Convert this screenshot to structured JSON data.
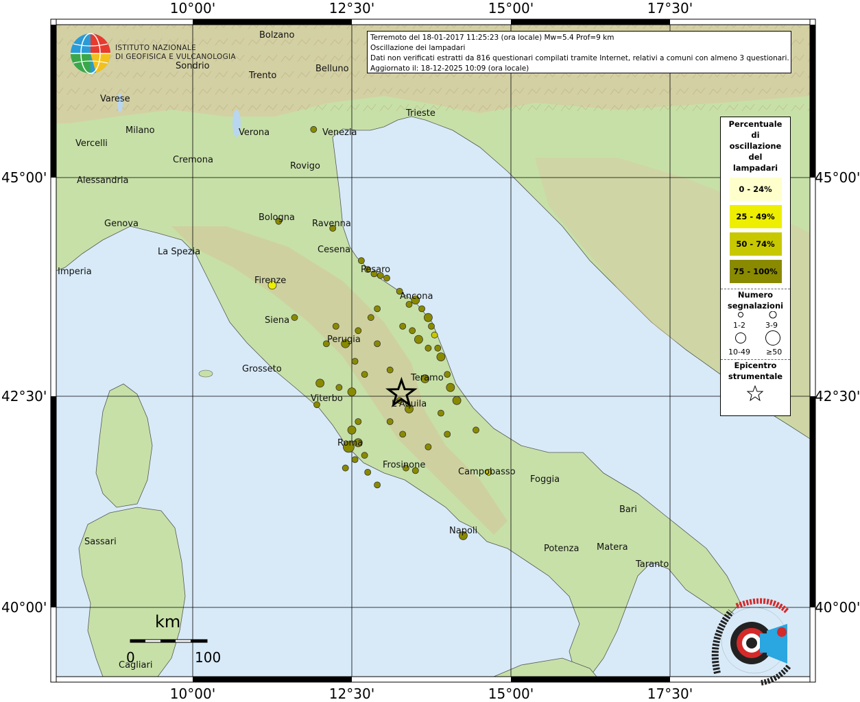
{
  "info_box": {
    "line1": "Terremoto del 18-01-2017 11:25:23 (ora locale) Mw=5.4 Prof=9 km",
    "line2": "Oscillazione dei lampadari",
    "line3": "Dati non verificati estratti da 816 questionari compilati tramite Internet, relativi a comuni con almeno 3 questionari.",
    "line4": "Aggiornato il: 18-12-2025 10:09 (ora locale)"
  },
  "logo": {
    "line1": "ISTITUTO NAZIONALE",
    "line2": "DI GEOFISICA E VULCANOLOGIA",
    "icon": "ingv-globe-icon"
  },
  "axes": {
    "top": [
      "10°00'",
      "12°30'",
      "15°00'",
      "17°30'"
    ],
    "bottom": [
      "10°00'",
      "12°30'",
      "15°00'",
      "17°30'"
    ],
    "left": [
      "45°00'",
      "42°30'",
      "40°00'"
    ],
    "right": [
      "45°00'",
      "42°30'",
      "40°00'"
    ]
  },
  "legend": {
    "title_lines": [
      "Percentuale",
      "di",
      "oscillazione",
      "del",
      "lampadari"
    ],
    "classes": [
      {
        "label": "0 - 24%",
        "color": "#ffffcc"
      },
      {
        "label": "25 - 49%",
        "color": "#eeee00"
      },
      {
        "label": "50 - 74%",
        "color": "#c8c800"
      },
      {
        "label": "75 - 100%",
        "color": "#8a8a00"
      }
    ],
    "count_title_lines": [
      "Numero",
      "segnalazioni"
    ],
    "count_classes": [
      "1-2",
      "3-9",
      "10-49",
      "≥50"
    ],
    "epicenter_title_lines": [
      "Epicentro",
      "strumentale"
    ],
    "epicenter_icon": "star-icon"
  },
  "scale": {
    "unit": "km",
    "min": "0",
    "max": "100"
  },
  "cities": [
    "Bolzano",
    "Sondrio",
    "Trento",
    "Belluno",
    "Varese",
    "Milano",
    "Verona",
    "Venezia",
    "Trieste",
    "Vercelli",
    "Cremona",
    "Rovigo",
    "Alessandria",
    "Genova",
    "Bologna",
    "Ravenna",
    "La Spezia",
    "Cesena",
    "Pesaro",
    "Imperia",
    "Firenze",
    "Ancona",
    "Siena",
    "Perugia",
    "Teramo",
    "Grosseto",
    "Viterbo",
    "L'Aquila",
    "Roma",
    "Frosinone",
    "Campobasso",
    "Foggia",
    "Bari",
    "Napoli",
    "Sassari",
    "Potenza",
    "Matera",
    "Taranto",
    "Cagliari"
  ],
  "map": {
    "sea_color": "#d8eaf8",
    "land_color": "#c7e0a8",
    "epicenter": {
      "lon": 13.28,
      "lat": 42.53
    },
    "observations": [
      {
        "lon": 11.9,
        "lat": 45.55,
        "cls": 3,
        "size": 1
      },
      {
        "lon": 11.35,
        "lat": 44.5,
        "cls": 3,
        "size": 1
      },
      {
        "lon": 12.2,
        "lat": 44.42,
        "cls": 3,
        "size": 1
      },
      {
        "lon": 11.25,
        "lat": 43.77,
        "cls": 1,
        "size": 2
      },
      {
        "lon": 12.65,
        "lat": 44.05,
        "cls": 3,
        "size": 1
      },
      {
        "lon": 12.75,
        "lat": 43.95,
        "cls": 3,
        "size": 1
      },
      {
        "lon": 12.85,
        "lat": 43.9,
        "cls": 3,
        "size": 1
      },
      {
        "lon": 12.95,
        "lat": 43.88,
        "cls": 3,
        "size": 1
      },
      {
        "lon": 13.05,
        "lat": 43.85,
        "cls": 3,
        "size": 1
      },
      {
        "lon": 13.25,
        "lat": 43.7,
        "cls": 3,
        "size": 1
      },
      {
        "lon": 13.5,
        "lat": 43.6,
        "cls": 3,
        "size": 2
      },
      {
        "lon": 13.4,
        "lat": 43.55,
        "cls": 3,
        "size": 1
      },
      {
        "lon": 13.6,
        "lat": 43.5,
        "cls": 3,
        "size": 1
      },
      {
        "lon": 13.7,
        "lat": 43.4,
        "cls": 3,
        "size": 2
      },
      {
        "lon": 13.75,
        "lat": 43.3,
        "cls": 3,
        "size": 1
      },
      {
        "lon": 13.8,
        "lat": 43.2,
        "cls": 2,
        "size": 1
      },
      {
        "lon": 13.85,
        "lat": 43.05,
        "cls": 3,
        "size": 1
      },
      {
        "lon": 13.9,
        "lat": 42.95,
        "cls": 3,
        "size": 2
      },
      {
        "lon": 13.7,
        "lat": 43.05,
        "cls": 3,
        "size": 1
      },
      {
        "lon": 13.55,
        "lat": 43.15,
        "cls": 3,
        "size": 2
      },
      {
        "lon": 13.45,
        "lat": 43.25,
        "cls": 3,
        "size": 1
      },
      {
        "lon": 13.3,
        "lat": 43.3,
        "cls": 3,
        "size": 1
      },
      {
        "lon": 12.9,
        "lat": 43.5,
        "cls": 3,
        "size": 1
      },
      {
        "lon": 12.8,
        "lat": 43.4,
        "cls": 3,
        "size": 1
      },
      {
        "lon": 12.6,
        "lat": 43.25,
        "cls": 3,
        "size": 1
      },
      {
        "lon": 12.4,
        "lat": 43.1,
        "cls": 3,
        "size": 2
      },
      {
        "lon": 12.1,
        "lat": 43.1,
        "cls": 3,
        "size": 1
      },
      {
        "lon": 11.6,
        "lat": 43.4,
        "cls": 3,
        "size": 1
      },
      {
        "lon": 12.25,
        "lat": 43.3,
        "cls": 3,
        "size": 1
      },
      {
        "lon": 12.55,
        "lat": 42.9,
        "cls": 3,
        "size": 1
      },
      {
        "lon": 12.7,
        "lat": 42.75,
        "cls": 3,
        "size": 1
      },
      {
        "lon": 12.5,
        "lat": 42.55,
        "cls": 3,
        "size": 2
      },
      {
        "lon": 12.0,
        "lat": 42.65,
        "cls": 3,
        "size": 2
      },
      {
        "lon": 11.95,
        "lat": 42.4,
        "cls": 3,
        "size": 1
      },
      {
        "lon": 12.3,
        "lat": 42.6,
        "cls": 3,
        "size": 1
      },
      {
        "lon": 12.6,
        "lat": 42.2,
        "cls": 3,
        "size": 1
      },
      {
        "lon": 12.5,
        "lat": 42.1,
        "cls": 3,
        "size": 2
      },
      {
        "lon": 12.45,
        "lat": 41.9,
        "cls": 3,
        "size": 3
      },
      {
        "lon": 12.6,
        "lat": 41.95,
        "cls": 3,
        "size": 2
      },
      {
        "lon": 12.7,
        "lat": 41.8,
        "cls": 3,
        "size": 1
      },
      {
        "lon": 12.55,
        "lat": 41.75,
        "cls": 3,
        "size": 1
      },
      {
        "lon": 12.4,
        "lat": 41.65,
        "cls": 3,
        "size": 1
      },
      {
        "lon": 12.75,
        "lat": 41.6,
        "cls": 3,
        "size": 1
      },
      {
        "lon": 12.9,
        "lat": 41.45,
        "cls": 3,
        "size": 1
      },
      {
        "lon": 13.35,
        "lat": 41.65,
        "cls": 3,
        "size": 1
      },
      {
        "lon": 13.5,
        "lat": 41.62,
        "cls": 3,
        "size": 1
      },
      {
        "lon": 13.1,
        "lat": 42.2,
        "cls": 3,
        "size": 1
      },
      {
        "lon": 13.3,
        "lat": 42.05,
        "cls": 3,
        "size": 1
      },
      {
        "lon": 13.4,
        "lat": 42.35,
        "cls": 3,
        "size": 2
      },
      {
        "lon": 13.25,
        "lat": 42.45,
        "cls": 3,
        "size": 1
      },
      {
        "lon": 13.65,
        "lat": 42.7,
        "cls": 3,
        "size": 2
      },
      {
        "lon": 14.0,
        "lat": 42.75,
        "cls": 3,
        "size": 1
      },
      {
        "lon": 14.05,
        "lat": 42.6,
        "cls": 3,
        "size": 2
      },
      {
        "lon": 14.15,
        "lat": 42.45,
        "cls": 3,
        "size": 2
      },
      {
        "lon": 13.9,
        "lat": 42.3,
        "cls": 3,
        "size": 1
      },
      {
        "lon": 14.0,
        "lat": 42.05,
        "cls": 3,
        "size": 1
      },
      {
        "lon": 13.7,
        "lat": 41.9,
        "cls": 3,
        "size": 1
      },
      {
        "lon": 14.45,
        "lat": 42.1,
        "cls": 3,
        "size": 1
      },
      {
        "lon": 14.65,
        "lat": 41.6,
        "cls": 2,
        "size": 1
      },
      {
        "lon": 14.25,
        "lat": 40.85,
        "cls": 3,
        "size": 2
      },
      {
        "lon": 13.1,
        "lat": 42.8,
        "cls": 3,
        "size": 1
      },
      {
        "lon": 12.9,
        "lat": 43.1,
        "cls": 3,
        "size": 1
      }
    ]
  }
}
